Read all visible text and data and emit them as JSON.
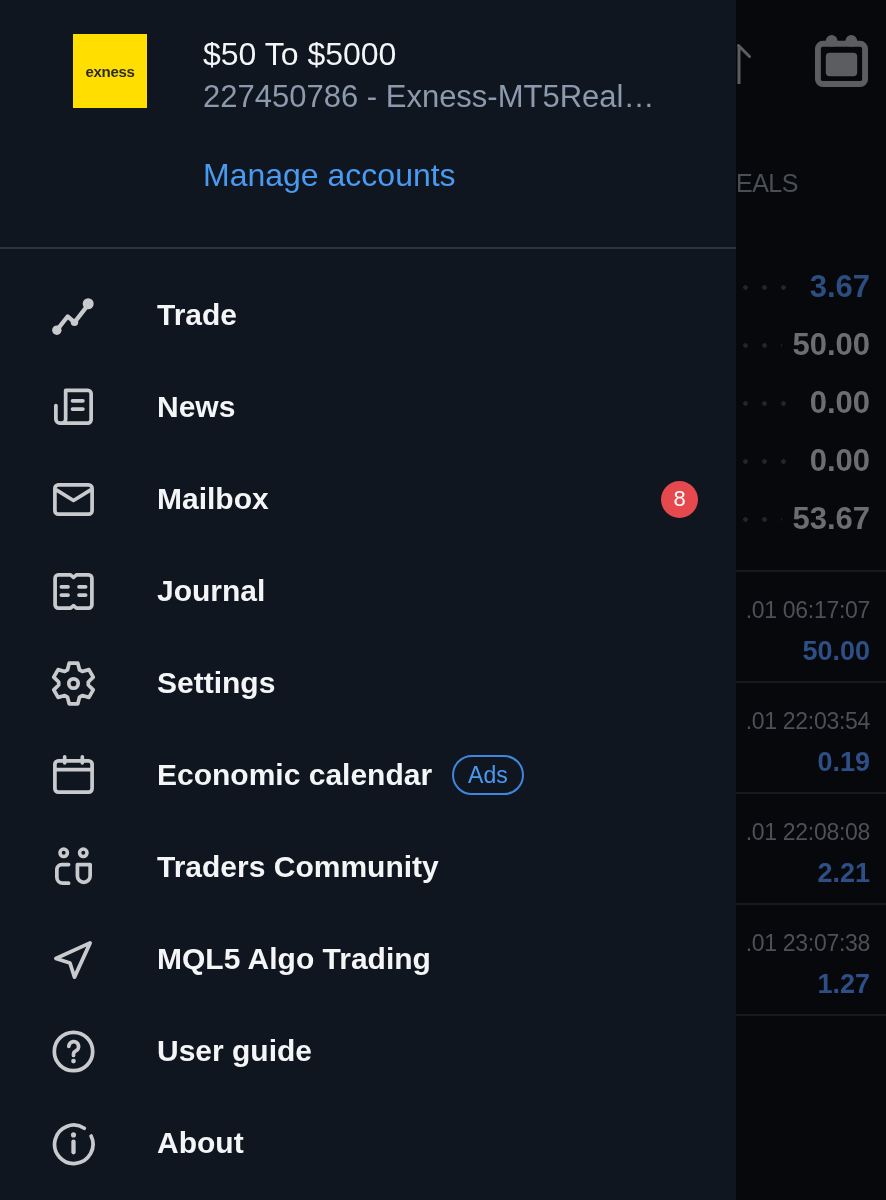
{
  "account": {
    "logo_text": "exness",
    "name": "$50 To $5000",
    "details": "227450786 - Exness-MT5Real…",
    "manage_link": "Manage accounts"
  },
  "menu": [
    {
      "label": "Trade"
    },
    {
      "label": "News"
    },
    {
      "label": "Mailbox",
      "badge": "8"
    },
    {
      "label": "Journal"
    },
    {
      "label": "Settings"
    },
    {
      "label": "Economic calendar",
      "tag": "Ads"
    },
    {
      "label": "Traders Community"
    },
    {
      "label": "MQL5 Algo Trading"
    },
    {
      "label": "User guide"
    },
    {
      "label": "About"
    }
  ],
  "background": {
    "tab_label": "EALS",
    "summary": [
      {
        "value": "3.67",
        "color": "#2c4d80"
      },
      {
        "value": "50.00",
        "color": "#6b6d71"
      },
      {
        "value": "0.00",
        "color": "#6b6d71"
      },
      {
        "value": "0.00",
        "color": "#6b6d71"
      },
      {
        "value": "53.67",
        "color": "#6b6d71"
      }
    ],
    "deals": [
      {
        "time": ".01 06:17:07",
        "amount": "50.00"
      },
      {
        "time": ".01 22:03:54",
        "amount": "0.19"
      },
      {
        "time": ".01 22:08:08",
        "amount": "2.21"
      },
      {
        "time": ".01 23:07:38",
        "amount": "1.27"
      }
    ]
  }
}
